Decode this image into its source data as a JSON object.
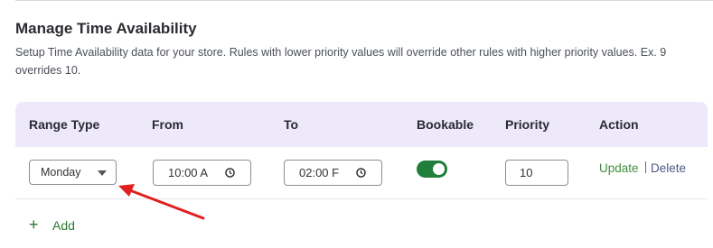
{
  "section": {
    "title": "Manage Time Availability",
    "description": "Setup Time Availability data for your store. Rules with lower priority values will override other rules with higher priority values. Ex. 9 overrides 10."
  },
  "table": {
    "headers": [
      "Range Type",
      "From",
      "To",
      "Bookable",
      "Priority",
      "Action"
    ],
    "rows": [
      {
        "range_type": "Monday",
        "from": "10:00 A",
        "to": "02:00 F",
        "bookable": true,
        "priority": "10",
        "update_label": "Update",
        "delete_label": "Delete"
      }
    ]
  },
  "add_label": "Add",
  "icons": {
    "add": "plus-icon",
    "time": "clock-icon",
    "dropdown": "chevron-down-icon",
    "annotation": "red-arrow"
  },
  "colors": {
    "header_bg": "#ede9fb",
    "toggle_on": "#1e7e3a",
    "update": "#3f8f3d",
    "delete": "#4b5a86",
    "arrow": "#e02020"
  }
}
